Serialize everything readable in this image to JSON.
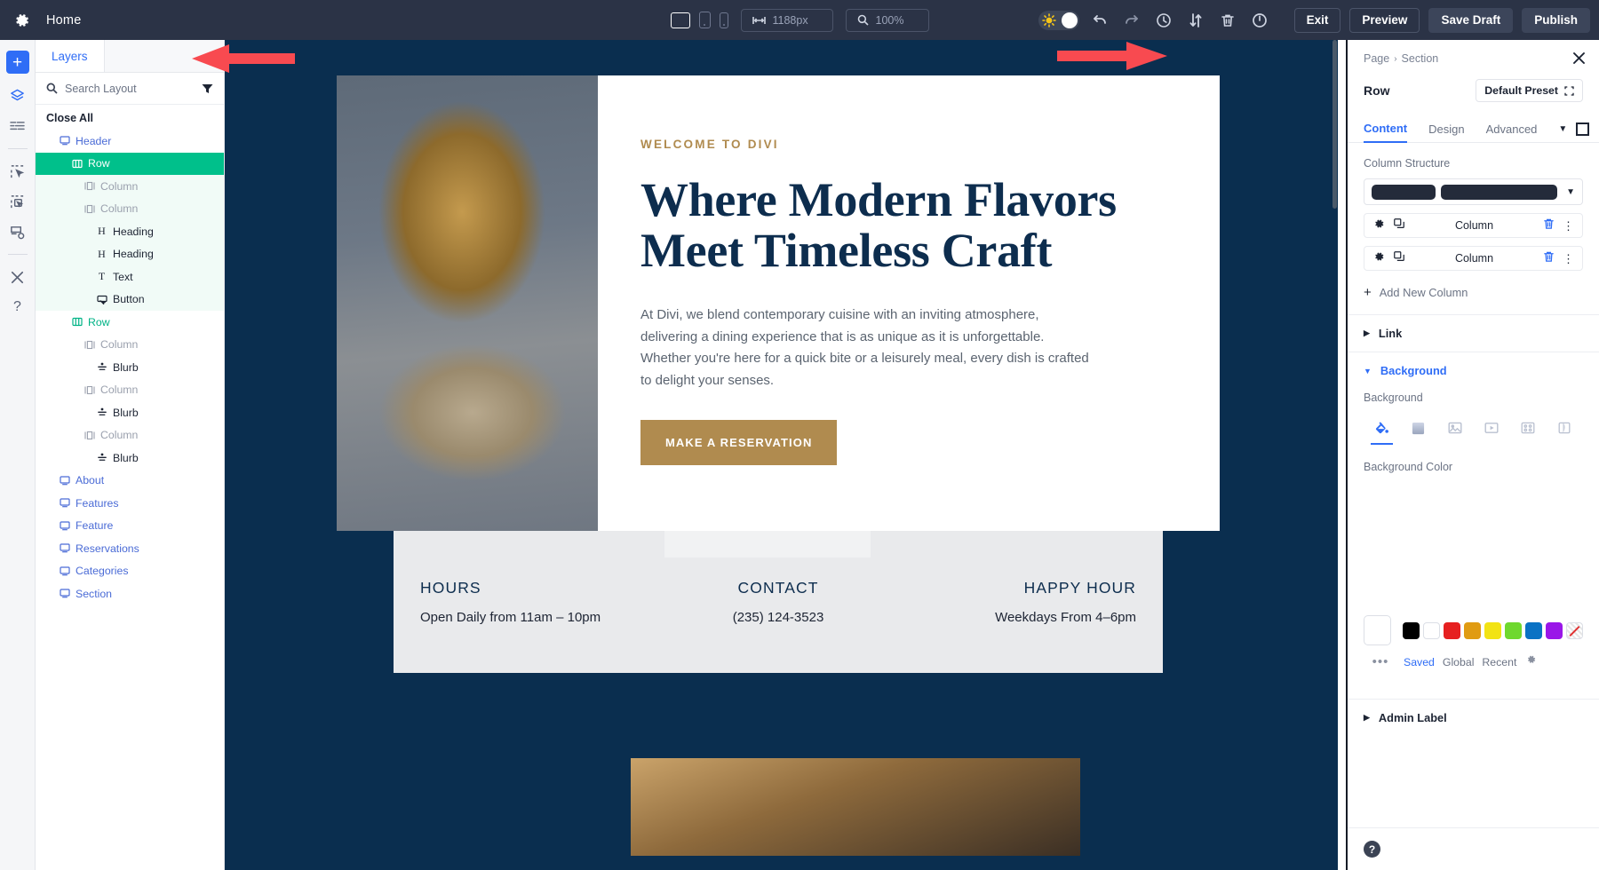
{
  "topbar": {
    "gear_icon": "gear-icon",
    "home_label": "Home",
    "devices": [
      {
        "name": "desktop",
        "active": true
      },
      {
        "name": "tablet",
        "active": false
      },
      {
        "name": "phone",
        "active": false
      }
    ],
    "width_value": "1188px",
    "zoom_value": "100%",
    "icons": [
      "sun-icon",
      "undo-icon",
      "redo-icon",
      "history-icon",
      "sort-icon",
      "trash-icon",
      "power-icon"
    ],
    "actions": [
      {
        "label": "Exit",
        "style": "outline"
      },
      {
        "label": "Preview",
        "style": "outline"
      },
      {
        "label": "Save Draft",
        "style": "filled"
      },
      {
        "label": "Publish",
        "style": "filled"
      }
    ]
  },
  "rail": {
    "add_label": "+",
    "icons": [
      "layers-icon",
      "wireframe-icon",
      "select-element-icon",
      "multi-select-icon",
      "save-layout-icon",
      "tools-icon",
      "help-icon"
    ]
  },
  "layers": {
    "tab_label": "Layers",
    "search_placeholder": "Search Layout",
    "filter_icon": "filter-icon",
    "close_all_label": "Close All",
    "items": [
      {
        "label": "Header",
        "type": "section",
        "icon": "section-icon",
        "level": "section",
        "state": "normal"
      },
      {
        "label": "Row",
        "type": "row",
        "icon": "row-icon",
        "level": "row",
        "state": "active"
      },
      {
        "label": "Column",
        "type": "column",
        "icon": "column-icon",
        "level": "col",
        "state": "tint"
      },
      {
        "label": "Column",
        "type": "column",
        "icon": "column-icon",
        "level": "col",
        "state": "tint"
      },
      {
        "label": "Heading",
        "type": "module",
        "icon": "heading-icon",
        "level": "mod",
        "state": "tint"
      },
      {
        "label": "Heading",
        "type": "module",
        "icon": "heading-icon",
        "level": "mod",
        "state": "tint"
      },
      {
        "label": "Text",
        "type": "module",
        "icon": "text-icon",
        "level": "mod",
        "state": "tint"
      },
      {
        "label": "Button",
        "type": "module",
        "icon": "button-icon",
        "level": "mod",
        "state": "tint"
      },
      {
        "label": "Row",
        "type": "row",
        "icon": "row-icon",
        "level": "row",
        "state": "green"
      },
      {
        "label": "Column",
        "type": "column",
        "icon": "column-icon",
        "level": "col",
        "state": "normal"
      },
      {
        "label": "Blurb",
        "type": "module",
        "icon": "blurb-icon",
        "level": "mod",
        "state": "normal"
      },
      {
        "label": "Column",
        "type": "column",
        "icon": "column-icon",
        "level": "col",
        "state": "normal"
      },
      {
        "label": "Blurb",
        "type": "module",
        "icon": "blurb-icon",
        "level": "mod",
        "state": "normal"
      },
      {
        "label": "Column",
        "type": "column",
        "icon": "column-icon",
        "level": "col",
        "state": "normal"
      },
      {
        "label": "Blurb",
        "type": "module",
        "icon": "blurb-icon",
        "level": "mod",
        "state": "normal"
      },
      {
        "label": "About",
        "type": "section",
        "icon": "section-icon",
        "level": "section",
        "state": "normal"
      },
      {
        "label": "Features",
        "type": "section",
        "icon": "section-icon",
        "level": "section",
        "state": "normal"
      },
      {
        "label": "Feature",
        "type": "section",
        "icon": "section-icon",
        "level": "section",
        "state": "normal"
      },
      {
        "label": "Reservations",
        "type": "section",
        "icon": "section-icon",
        "level": "section",
        "state": "normal"
      },
      {
        "label": "Categories",
        "type": "section",
        "icon": "section-icon",
        "level": "section",
        "state": "normal"
      },
      {
        "label": "Section",
        "type": "section",
        "icon": "section-icon",
        "level": "section",
        "state": "normal"
      }
    ]
  },
  "canvas": {
    "background_color": "#0a2e4f",
    "hero": {
      "eyebrow": "WELCOME TO DIVI",
      "heading_line1": "Where Modern Flavors",
      "heading_line2": "Meet Timeless Craft",
      "paragraph": "At Divi, we blend contemporary cuisine with an inviting atmosphere, delivering a dining experience that is as unique as it is unforgettable. Whether you're here for a quick bite or a leisurely meal, every dish is crafted to delight your senses.",
      "button_label": "MAKE A RESERVATION",
      "accent_color": "#b08b4f",
      "heading_color": "#0d2d4e"
    },
    "info": [
      {
        "title": "HOURS",
        "value": "Open Daily from 11am – 10pm"
      },
      {
        "title": "CONTACT",
        "value": "(235) 124-3523"
      },
      {
        "title": "HAPPY HOUR",
        "value": "Weekdays From 4–6pm"
      }
    ]
  },
  "rpanel": {
    "breadcrumb_parent": "Page",
    "breadcrumb_child": "Section",
    "close_icon": "close-icon",
    "title": "Row",
    "preset_label": "Default Preset",
    "tabs": [
      {
        "label": "Content",
        "active": true
      },
      {
        "label": "Design",
        "active": false
      },
      {
        "label": "Advanced",
        "active": false
      }
    ],
    "column_structure_label": "Column Structure",
    "columns": [
      {
        "label": "Column"
      },
      {
        "label": "Column"
      }
    ],
    "add_column_label": "Add New Column",
    "accordions": [
      {
        "label": "Link",
        "open": false
      },
      {
        "label": "Background",
        "open": true
      }
    ],
    "background_field_label": "Background",
    "background_types": [
      "fill-icon",
      "gradient-icon",
      "image-icon",
      "video-icon",
      "pattern-icon",
      "mask-icon"
    ],
    "background_color_label": "Background Color",
    "swatches": [
      {
        "hex": "#000000"
      },
      {
        "hex": "#ffffff"
      },
      {
        "hex": "#e62020"
      },
      {
        "hex": "#e09b12"
      },
      {
        "hex": "#f2e314"
      },
      {
        "hex": "#6fd82e"
      },
      {
        "hex": "#0a72c4"
      },
      {
        "hex": "#9a16e8"
      },
      {
        "hex": "none"
      }
    ],
    "swatch_tabs": [
      {
        "label": "Saved",
        "active": true
      },
      {
        "label": "Global",
        "active": false
      },
      {
        "label": "Recent",
        "active": false
      }
    ],
    "swatch_settings_icon": "gear-icon",
    "admin_label": "Admin Label",
    "help_icon": "help-icon"
  },
  "annotations": {
    "arrow_color": "#f84a50",
    "arrows": [
      {
        "name": "arrow-left-panel",
        "direction": "left"
      },
      {
        "name": "arrow-right-panel",
        "direction": "right"
      }
    ]
  }
}
